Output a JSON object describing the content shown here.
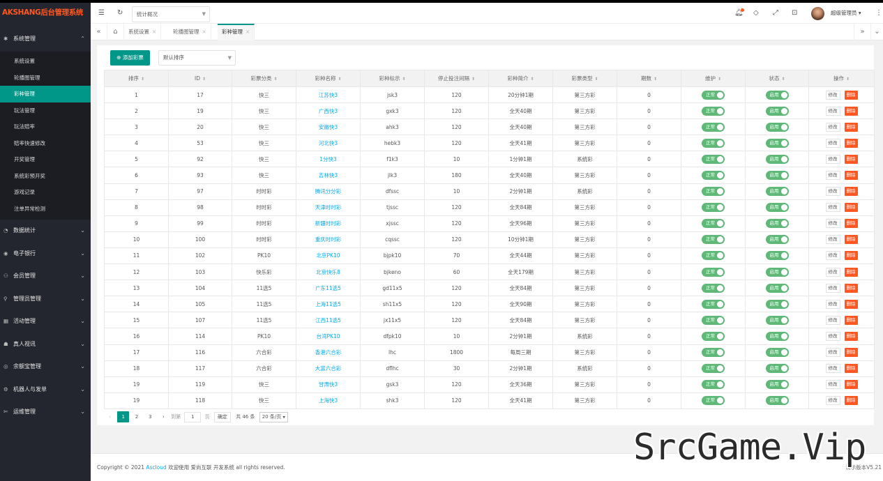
{
  "app": {
    "logo": "AKSHANG后台管理系统"
  },
  "sidebar": {
    "system": {
      "label": "系统管理",
      "items": [
        "系统设置",
        "轮播图管理",
        "彩种管理",
        "玩法管理",
        "玩法赔率",
        "赔率快速修改",
        "开奖管理",
        "系统彩预开奖",
        "游戏记录",
        "注单异常检测"
      ]
    },
    "groups": [
      "数据统计",
      "电子银行",
      "会员管理",
      "管理员管理",
      "活动管理",
      "真人视讯",
      "余额宝管理",
      "机器人与发单",
      "运维管理"
    ]
  },
  "header": {
    "selector": "统计概况",
    "user": "超级管理员"
  },
  "tabs": [
    "系统设置",
    "轮播图管理",
    "彩种管理"
  ],
  "toolbar": {
    "add": "添加彩票",
    "sort": "默认排序"
  },
  "table": {
    "headers": [
      "排序",
      "ID",
      "彩票分类",
      "彩种名称",
      "彩种标示",
      "停止投注间隔",
      "彩种简介",
      "彩票类型",
      "期数",
      "维护",
      "状态",
      "操作"
    ],
    "labels": {
      "maintain": "正常",
      "status": "启用",
      "edit": "修改",
      "delete": "删除"
    },
    "rows": [
      [
        "1",
        "17",
        "快三",
        "江苏快3",
        "jsk3",
        "120",
        "20分钟1期",
        "第三方彩",
        "0"
      ],
      [
        "2",
        "19",
        "快三",
        "广西快3",
        "gxk3",
        "120",
        "全天40期",
        "第三方彩",
        "0"
      ],
      [
        "3",
        "20",
        "快三",
        "安徽快3",
        "ahk3",
        "120",
        "全天40期",
        "第三方彩",
        "0"
      ],
      [
        "4",
        "53",
        "快三",
        "河北快3",
        "hebk3",
        "120",
        "全天41期",
        "第三方彩",
        "0"
      ],
      [
        "5",
        "92",
        "快三",
        "1分快3",
        "f1k3",
        "10",
        "1分钟1期",
        "系统彩",
        "0"
      ],
      [
        "6",
        "93",
        "快三",
        "吉林快3",
        "jlk3",
        "180",
        "全天40期",
        "第三方彩",
        "0"
      ],
      [
        "7",
        "97",
        "时时彩",
        "腾讯分分彩",
        "dfssc",
        "10",
        "2分钟1期",
        "系统彩",
        "0"
      ],
      [
        "8",
        "98",
        "时时彩",
        "天津时时彩",
        "tjssc",
        "120",
        "全天84期",
        "第三方彩",
        "0"
      ],
      [
        "9",
        "99",
        "时时彩",
        "新疆时时彩",
        "xjssc",
        "120",
        "全天96期",
        "第三方彩",
        "0"
      ],
      [
        "10",
        "100",
        "时时彩",
        "重庆时时彩",
        "cqssc",
        "120",
        "10分钟1期",
        "第三方彩",
        "0"
      ],
      [
        "11",
        "102",
        "PK10",
        "北京PK10",
        "bjpk10",
        "70",
        "全天44期",
        "第三方彩",
        "0"
      ],
      [
        "12",
        "103",
        "快乐彩",
        "北京快乐8",
        "bjkeno",
        "60",
        "全天179期",
        "第三方彩",
        "0"
      ],
      [
        "13",
        "104",
        "11选5",
        "广东11选5",
        "gd11x5",
        "120",
        "全天84期",
        "第三方彩",
        "0"
      ],
      [
        "14",
        "105",
        "11选5",
        "上海11选5",
        "sh11x5",
        "120",
        "全天90期",
        "第三方彩",
        "0"
      ],
      [
        "15",
        "107",
        "11选5",
        "江西11选5",
        "jx11x5",
        "120",
        "全天84期",
        "第三方彩",
        "0"
      ],
      [
        "16",
        "114",
        "PK10",
        "台湾PK10",
        "dfpk10",
        "10",
        "2分钟1期",
        "系统彩",
        "0"
      ],
      [
        "17",
        "116",
        "六合彩",
        "香港六合彩",
        "lhc",
        "1800",
        "每周三期",
        "第三方彩",
        "0"
      ],
      [
        "18",
        "117",
        "六合彩",
        "大富六合彩",
        "dflhc",
        "30",
        "2分钟1期",
        "系统彩",
        "0"
      ],
      [
        "19",
        "119",
        "快三",
        "甘肃快3",
        "gsk3",
        "120",
        "全天36期",
        "第三方彩",
        "0"
      ],
      [
        "19",
        "118",
        "快三",
        "上海快3",
        "shk3",
        "120",
        "全天41期",
        "第三方彩",
        "0"
      ]
    ]
  },
  "pager": {
    "p1": "1",
    "p2": "2",
    "p3": "3",
    "goto": "到第",
    "page_val": "1",
    "page_unit": "页",
    "ok": "确定",
    "total": "共 46 条",
    "size": "20 条/页"
  },
  "footer": {
    "prefix": "Copyright © 2021 ",
    "brand": "Ascloud",
    "rest": " 欢迎使用 爱尚互联 开发系统 all rights reserved.",
    "version": "演示版本V5.21"
  },
  "watermark": "SrcGame.Vip"
}
